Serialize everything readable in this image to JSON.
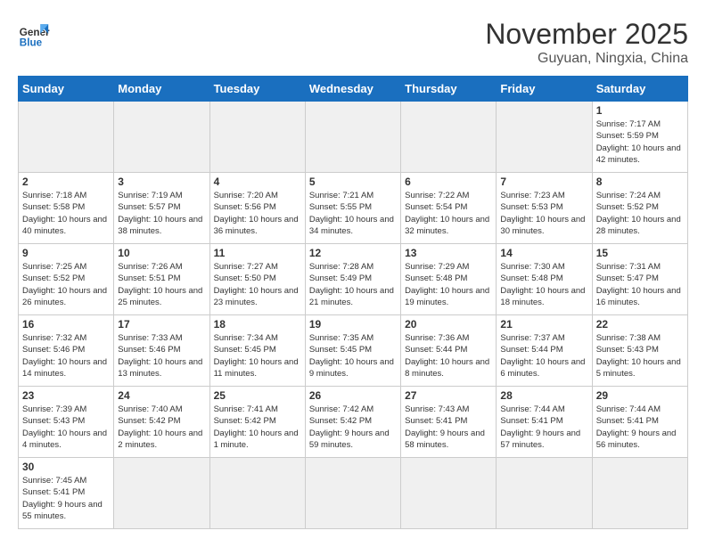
{
  "header": {
    "logo_general": "General",
    "logo_blue": "Blue",
    "month_title": "November 2025",
    "location": "Guyuan, Ningxia, China"
  },
  "days_of_week": [
    "Sunday",
    "Monday",
    "Tuesday",
    "Wednesday",
    "Thursday",
    "Friday",
    "Saturday"
  ],
  "weeks": [
    [
      {
        "day": "",
        "info": "",
        "empty": true
      },
      {
        "day": "",
        "info": "",
        "empty": true
      },
      {
        "day": "",
        "info": "",
        "empty": true
      },
      {
        "day": "",
        "info": "",
        "empty": true
      },
      {
        "day": "",
        "info": "",
        "empty": true
      },
      {
        "day": "",
        "info": "",
        "empty": true
      },
      {
        "day": "1",
        "info": "Sunrise: 7:17 AM\nSunset: 5:59 PM\nDaylight: 10 hours and 42 minutes."
      }
    ],
    [
      {
        "day": "2",
        "info": "Sunrise: 7:18 AM\nSunset: 5:58 PM\nDaylight: 10 hours and 40 minutes."
      },
      {
        "day": "3",
        "info": "Sunrise: 7:19 AM\nSunset: 5:57 PM\nDaylight: 10 hours and 38 minutes."
      },
      {
        "day": "4",
        "info": "Sunrise: 7:20 AM\nSunset: 5:56 PM\nDaylight: 10 hours and 36 minutes."
      },
      {
        "day": "5",
        "info": "Sunrise: 7:21 AM\nSunset: 5:55 PM\nDaylight: 10 hours and 34 minutes."
      },
      {
        "day": "6",
        "info": "Sunrise: 7:22 AM\nSunset: 5:54 PM\nDaylight: 10 hours and 32 minutes."
      },
      {
        "day": "7",
        "info": "Sunrise: 7:23 AM\nSunset: 5:53 PM\nDaylight: 10 hours and 30 minutes."
      },
      {
        "day": "8",
        "info": "Sunrise: 7:24 AM\nSunset: 5:52 PM\nDaylight: 10 hours and 28 minutes."
      }
    ],
    [
      {
        "day": "9",
        "info": "Sunrise: 7:25 AM\nSunset: 5:52 PM\nDaylight: 10 hours and 26 minutes."
      },
      {
        "day": "10",
        "info": "Sunrise: 7:26 AM\nSunset: 5:51 PM\nDaylight: 10 hours and 25 minutes."
      },
      {
        "day": "11",
        "info": "Sunrise: 7:27 AM\nSunset: 5:50 PM\nDaylight: 10 hours and 23 minutes."
      },
      {
        "day": "12",
        "info": "Sunrise: 7:28 AM\nSunset: 5:49 PM\nDaylight: 10 hours and 21 minutes."
      },
      {
        "day": "13",
        "info": "Sunrise: 7:29 AM\nSunset: 5:48 PM\nDaylight: 10 hours and 19 minutes."
      },
      {
        "day": "14",
        "info": "Sunrise: 7:30 AM\nSunset: 5:48 PM\nDaylight: 10 hours and 18 minutes."
      },
      {
        "day": "15",
        "info": "Sunrise: 7:31 AM\nSunset: 5:47 PM\nDaylight: 10 hours and 16 minutes."
      }
    ],
    [
      {
        "day": "16",
        "info": "Sunrise: 7:32 AM\nSunset: 5:46 PM\nDaylight: 10 hours and 14 minutes."
      },
      {
        "day": "17",
        "info": "Sunrise: 7:33 AM\nSunset: 5:46 PM\nDaylight: 10 hours and 13 minutes."
      },
      {
        "day": "18",
        "info": "Sunrise: 7:34 AM\nSunset: 5:45 PM\nDaylight: 10 hours and 11 minutes."
      },
      {
        "day": "19",
        "info": "Sunrise: 7:35 AM\nSunset: 5:45 PM\nDaylight: 10 hours and 9 minutes."
      },
      {
        "day": "20",
        "info": "Sunrise: 7:36 AM\nSunset: 5:44 PM\nDaylight: 10 hours and 8 minutes."
      },
      {
        "day": "21",
        "info": "Sunrise: 7:37 AM\nSunset: 5:44 PM\nDaylight: 10 hours and 6 minutes."
      },
      {
        "day": "22",
        "info": "Sunrise: 7:38 AM\nSunset: 5:43 PM\nDaylight: 10 hours and 5 minutes."
      }
    ],
    [
      {
        "day": "23",
        "info": "Sunrise: 7:39 AM\nSunset: 5:43 PM\nDaylight: 10 hours and 4 minutes."
      },
      {
        "day": "24",
        "info": "Sunrise: 7:40 AM\nSunset: 5:42 PM\nDaylight: 10 hours and 2 minutes."
      },
      {
        "day": "25",
        "info": "Sunrise: 7:41 AM\nSunset: 5:42 PM\nDaylight: 10 hours and 1 minute."
      },
      {
        "day": "26",
        "info": "Sunrise: 7:42 AM\nSunset: 5:42 PM\nDaylight: 9 hours and 59 minutes."
      },
      {
        "day": "27",
        "info": "Sunrise: 7:43 AM\nSunset: 5:41 PM\nDaylight: 9 hours and 58 minutes."
      },
      {
        "day": "28",
        "info": "Sunrise: 7:44 AM\nSunset: 5:41 PM\nDaylight: 9 hours and 57 minutes."
      },
      {
        "day": "29",
        "info": "Sunrise: 7:44 AM\nSunset: 5:41 PM\nDaylight: 9 hours and 56 minutes."
      }
    ],
    [
      {
        "day": "30",
        "info": "Sunrise: 7:45 AM\nSunset: 5:41 PM\nDaylight: 9 hours and 55 minutes.",
        "last_row": true
      },
      {
        "day": "",
        "info": "",
        "empty": true,
        "last_row": true
      },
      {
        "day": "",
        "info": "",
        "empty": true,
        "last_row": true
      },
      {
        "day": "",
        "info": "",
        "empty": true,
        "last_row": true
      },
      {
        "day": "",
        "info": "",
        "empty": true,
        "last_row": true
      },
      {
        "day": "",
        "info": "",
        "empty": true,
        "last_row": true
      },
      {
        "day": "",
        "info": "",
        "empty": true,
        "last_row": true
      }
    ]
  ]
}
